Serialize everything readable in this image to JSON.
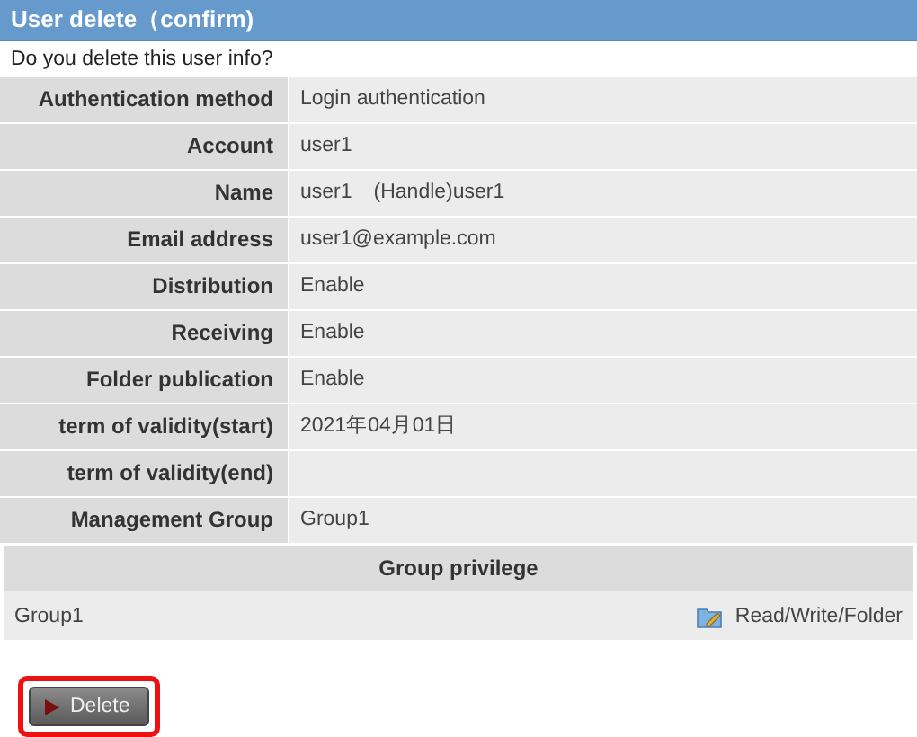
{
  "window": {
    "title": "User delete（confirm)"
  },
  "prompt": "Do you delete this user info?",
  "fields": [
    {
      "label": "Authentication method",
      "value": "Login authentication"
    },
    {
      "label": "Account",
      "value": "user1"
    },
    {
      "label": "Name",
      "value": "user1　(Handle)user1"
    },
    {
      "label": "Email address",
      "value": "user1@example.com"
    },
    {
      "label": "Distribution",
      "value": "Enable"
    },
    {
      "label": "Receiving",
      "value": "Enable"
    },
    {
      "label": "Folder publication",
      "value": "Enable"
    },
    {
      "label": "term of validity(start)",
      "value": "2021年04月01日"
    },
    {
      "label": "term of validity(end)"
    },
    {
      "label": "Management Group",
      "value": "Group1"
    }
  ],
  "group_privilege": {
    "heading": "Group privilege",
    "rows": [
      {
        "group": "Group1",
        "privilege": "Read/Write/Folder"
      }
    ]
  },
  "delete_button": {
    "label": "Delete",
    "highlighted": true
  }
}
